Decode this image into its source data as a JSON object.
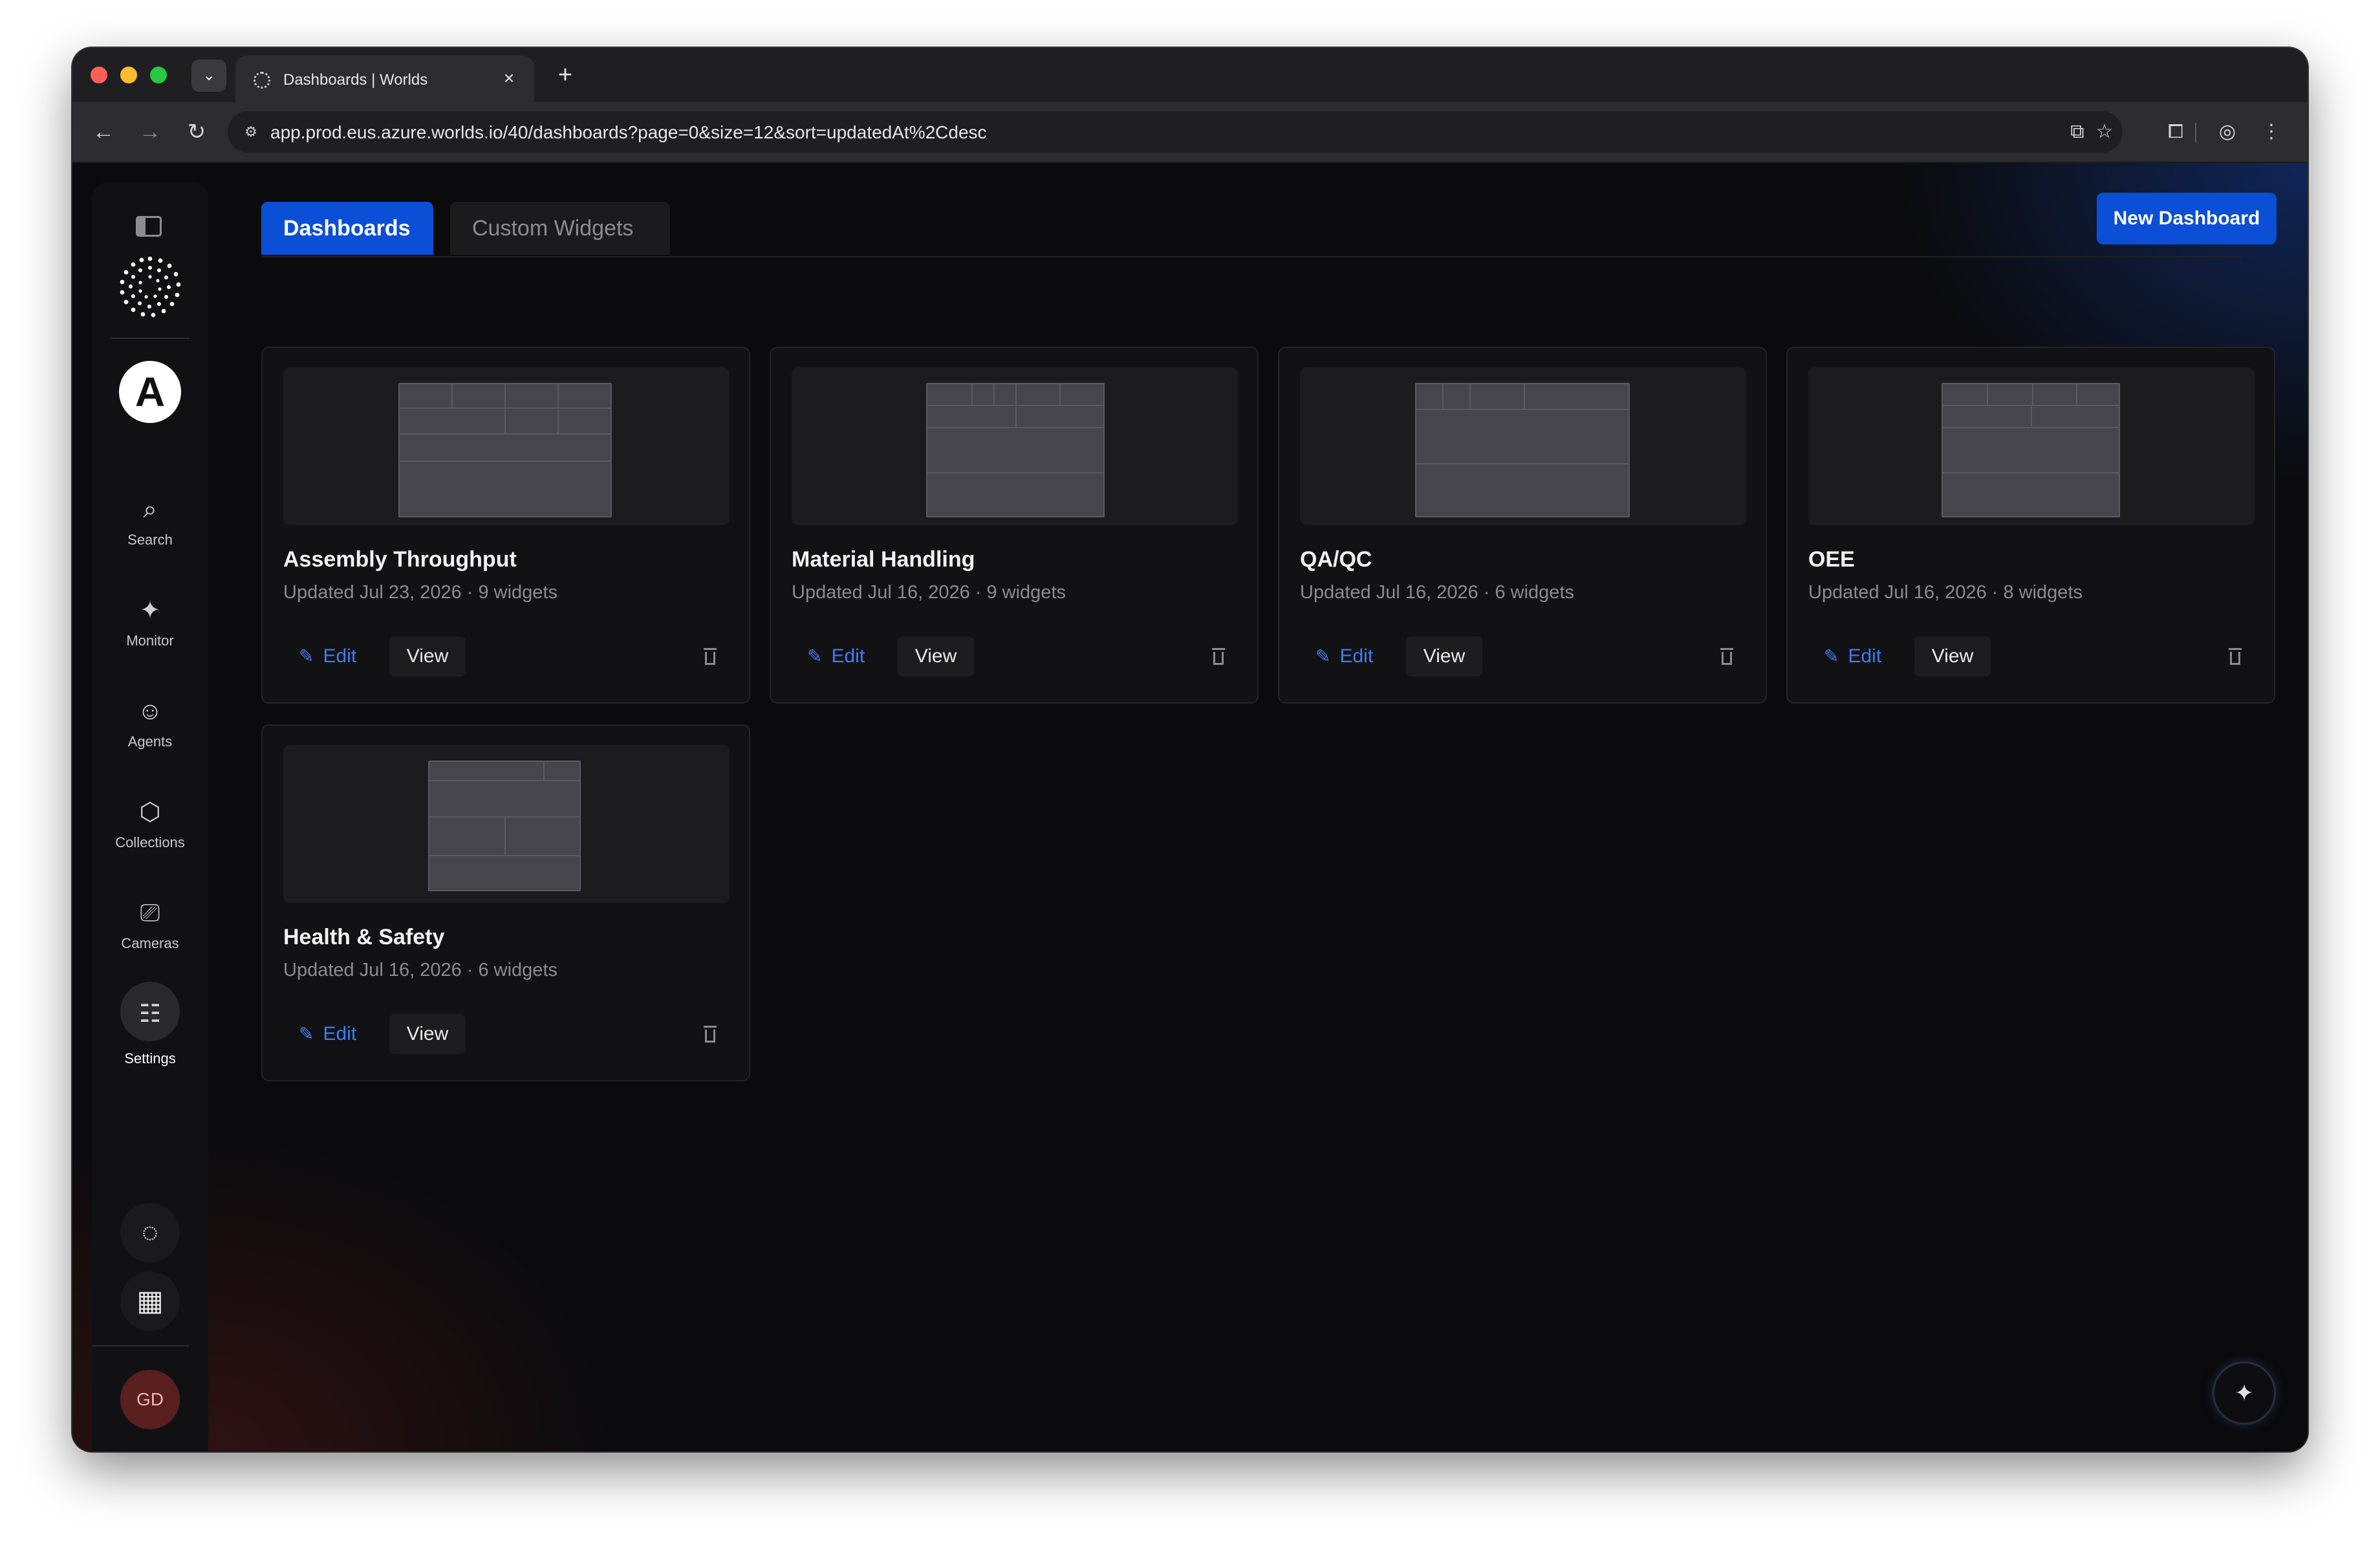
{
  "browser": {
    "tab_title": "Dashboards | Worlds",
    "url": "app.prod.eus.azure.worlds.io/40/dashboards?page=0&size=12&sort=updatedAt%2Cdesc",
    "new_tab_glyph": "+",
    "close_glyph": "×"
  },
  "sidebar": {
    "org_initial": "A",
    "items": [
      {
        "label": "Search",
        "icon": "search-icon"
      },
      {
        "label": "Monitor",
        "icon": "monitor-icon"
      },
      {
        "label": "Agents",
        "icon": "robot-icon"
      },
      {
        "label": "Collections",
        "icon": "cube-icon"
      },
      {
        "label": "Cameras",
        "icon": "camera-icon"
      },
      {
        "label": "Settings",
        "icon": "sliders-icon"
      }
    ],
    "user_initials": "GD"
  },
  "tabs": {
    "dashboards": "Dashboards",
    "custom_widgets": "Custom Widgets"
  },
  "new_dashboard_label": "New Dashboard",
  "card_actions": {
    "edit": "Edit",
    "view": "View"
  },
  "dashboards": [
    {
      "title": "Assembly Throughput",
      "meta": "Updated Jul 23, 2026 · 9 widgets"
    },
    {
      "title": "Material Handling",
      "meta": "Updated Jul 16, 2026 · 9 widgets"
    },
    {
      "title": "QA/QC",
      "meta": "Updated Jul 16, 2026 · 6 widgets"
    },
    {
      "title": "OEE",
      "meta": "Updated Jul 16, 2026 · 8 widgets"
    },
    {
      "title": "Health & Safety",
      "meta": "Updated Jul 16, 2026 · 6 widgets"
    }
  ],
  "colors": {
    "accent": "#0b4fd6",
    "edit_link": "#3d7cf5",
    "background": "#0b0b0d"
  }
}
